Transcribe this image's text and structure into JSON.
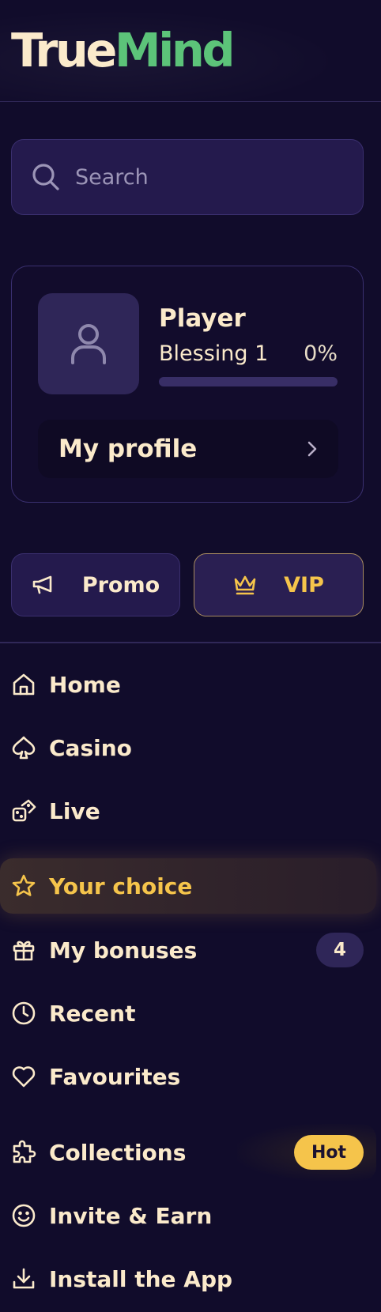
{
  "brand": {
    "part1": "True",
    "part2": "Mind"
  },
  "search": {
    "placeholder": "Search"
  },
  "profile": {
    "name": "Player",
    "level": "Blessing 1",
    "progress_text": "0%",
    "progress_fraction": 0,
    "link_label": "My profile"
  },
  "buttons": {
    "promo_label": "Promo",
    "vip_label": "VIP"
  },
  "nav": {
    "items": [
      {
        "label": "Home",
        "icon": "home-icon"
      },
      {
        "label": "Casino",
        "icon": "spade-icon"
      },
      {
        "label": "Live",
        "icon": "dice-icon"
      },
      {
        "label": "Your choice",
        "icon": "star-icon",
        "active": true
      },
      {
        "label": "My bonuses",
        "icon": "gift-icon",
        "badge": "4"
      },
      {
        "label": "Recent",
        "icon": "clock-icon"
      },
      {
        "label": "Favourites",
        "icon": "heart-icon"
      },
      {
        "label": "Collections",
        "icon": "puzzle-icon",
        "badge": "Hot"
      },
      {
        "label": "Invite & Earn",
        "icon": "smile-icon"
      },
      {
        "label": "Install the App",
        "icon": "download-icon"
      }
    ]
  },
  "colors": {
    "background": "#110c2b",
    "accent_gold": "#f5c44b",
    "brand_green": "#5cc379",
    "text_cream": "#fbeacb"
  }
}
